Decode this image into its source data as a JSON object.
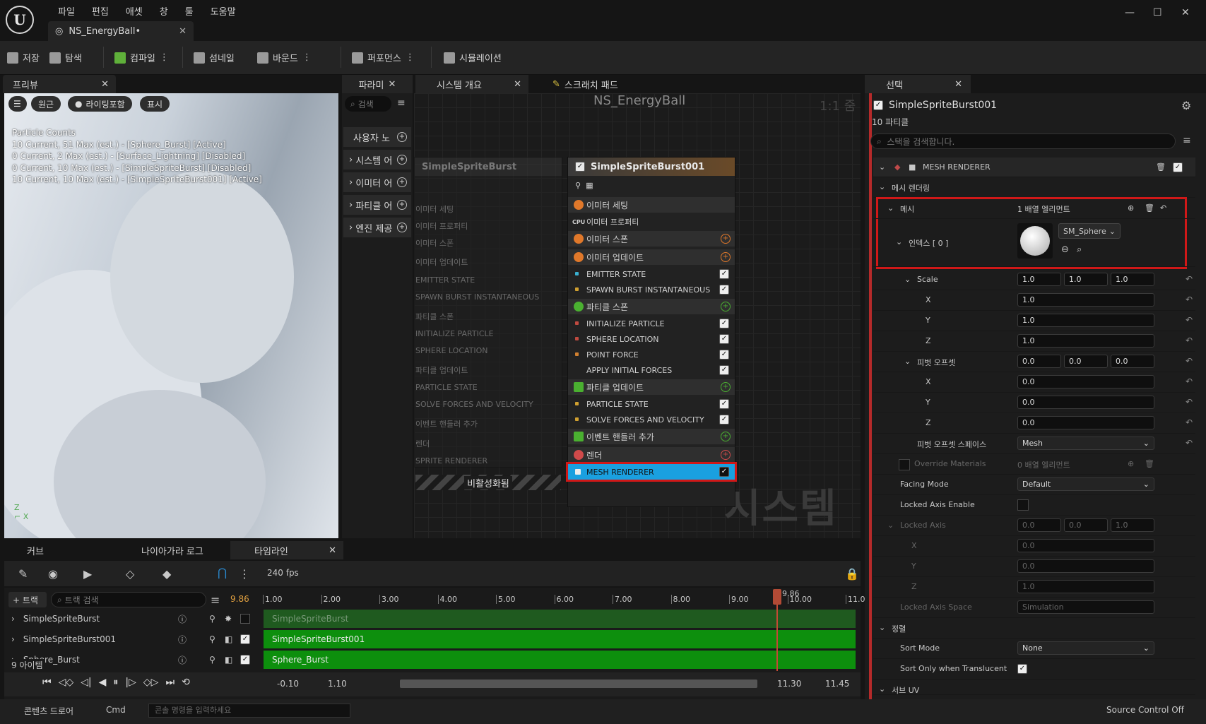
{
  "menu": [
    "파일",
    "편집",
    "애셋",
    "창",
    "툴",
    "도움말"
  ],
  "doc_tab": "NS_EnergyBall•",
  "toolbar": {
    "save": "저장",
    "browse": "탐색",
    "compile": "컴파일",
    "thumbnail": "섬네일",
    "bounds": "바운드",
    "performance": "퍼포먼스",
    "simulation": "시뮬레이션"
  },
  "preview": {
    "tab": "프리뷰",
    "perspective": "원근",
    "lighting": "라이팅포함",
    "show": "표시",
    "counts_title": "Particle Counts",
    "counts": [
      "10 Current, 51 Max (est.) - [Sphere_Burst] [Active]",
      "0 Current, 2 Max (est.) - [Surface_Lightning] [Disabled]",
      "0 Current, 10 Max (est.) - [SimpleSpriteBurst] [Disabled]",
      "10 Current, 10 Max (est.) - [SimpleSpriteBurst001] [Active]"
    ]
  },
  "params": {
    "tab": "파라미",
    "search": "검색",
    "rows": [
      "사용자 노",
      "시스템 어",
      "이미터 어",
      "파티클 어",
      "엔진 제공"
    ]
  },
  "graph": {
    "tab_overview": "시스템 개요",
    "tab_scratch": "스크래치 패드",
    "title": "NS_EnergyBall",
    "zoom": "1:1 줌",
    "watermark": "시스템",
    "disabled_label": "비활성화됨"
  },
  "node_left": {
    "title": "SimpleSpriteBurst",
    "rows": [
      "이미터 세팅",
      "이미터 프로퍼티",
      "이미터 스폰",
      "이미터 업데이트",
      "EMITTER STATE",
      "SPAWN BURST INSTANTANEOUS",
      "파티클 스폰",
      "INITIALIZE PARTICLE",
      "SPHERE LOCATION",
      "파티클 업데이트",
      "PARTICLE STATE",
      "SOLVE FORCES AND VELOCITY",
      "이벤트 핸들러 추가",
      "렌더",
      "SPRITE RENDERER"
    ]
  },
  "node_right": {
    "title": "SimpleSpriteBurst001",
    "rows": [
      "이미터 세팅",
      "이미터 프로퍼티",
      "이미터 스폰",
      "이미터 업데이트",
      "EMITTER STATE",
      "SPAWN BURST INSTANTANEOUS",
      "파티클 스폰",
      "INITIALIZE PARTICLE",
      "SPHERE LOCATION",
      "POINT FORCE",
      "APPLY INITIAL FORCES",
      "파티클 업데이트",
      "PARTICLE STATE",
      "SOLVE FORCES AND VELOCITY",
      "이벤트 핸들러 추가",
      "렌더",
      "MESH RENDERER"
    ],
    "cpu": "CPU"
  },
  "selection": {
    "tab": "선택",
    "name": "SimpleSpriteBurst001",
    "count": "10 파티클",
    "search": "스택을 검색합니다.",
    "module": "MESH RENDERER",
    "section_mesh_rendering": "메시 렌더링",
    "mesh": "메시",
    "mesh_value": "1 배열 엘리먼트",
    "index": "인덱스 [ 0 ]",
    "mesh_asset": "SM_Sphere",
    "scale": "Scale",
    "scale_vals": [
      "1.0",
      "1.0",
      "1.0"
    ],
    "x": "X",
    "y": "Y",
    "z": "Z",
    "sx": "1.0",
    "sy": "1.0",
    "sz": "1.0",
    "pivot": "피벗 오프셋",
    "pivot_vals": [
      "0.0",
      "0.0",
      "0.0"
    ],
    "px": "0.0",
    "py": "0.0",
    "pz": "0.0",
    "pivot_space": "피벗 오프셋 스페이스",
    "pivot_space_val": "Mesh",
    "override": "Override Materials",
    "override_val": "0 배열 엘리먼트",
    "facing": "Facing Mode",
    "facing_val": "Default",
    "locked_enable": "Locked Axis Enable",
    "locked_axis": "Locked Axis",
    "locked_vals": [
      "0.0",
      "0.0",
      "1.0"
    ],
    "lx": "0.0",
    "ly": "0.0",
    "lz": "1.0",
    "locked_space": "Locked Axis Space",
    "locked_space_val": "Simulation",
    "sort_section": "정렬",
    "sort_mode": "Sort Mode",
    "sort_mode_val": "None",
    "sort_translucent": "Sort Only when Translucent",
    "next_section": "서브 UV"
  },
  "bottom": {
    "tab_curve": "커브",
    "tab_log": "나이아가라 로그",
    "tab_timeline": "타임라인",
    "fps": "240 fps",
    "add_track": "+ 트랙",
    "track_search": "트랙 검색",
    "time": "9.86",
    "playhead": "9.86",
    "items": "9 아이템",
    "tracks": [
      "SimpleSpriteBurst",
      "SimpleSpriteBurst001",
      "Sphere_Burst"
    ],
    "ruler": [
      "1.00",
      "2.00",
      "3.00",
      "4.00",
      "5.00",
      "6.00",
      "7.00",
      "8.00",
      "9.00",
      "10.00",
      "11.0"
    ],
    "range_start": "-0.10",
    "range_in": "1.10",
    "range_out": "11.30",
    "range_end": "11.45"
  },
  "status": {
    "content_drawer": "콘텐츠 드로어",
    "cmd": "Cmd",
    "console": "콘솔 명령을 입력하세요",
    "source": "Source Control Off"
  }
}
